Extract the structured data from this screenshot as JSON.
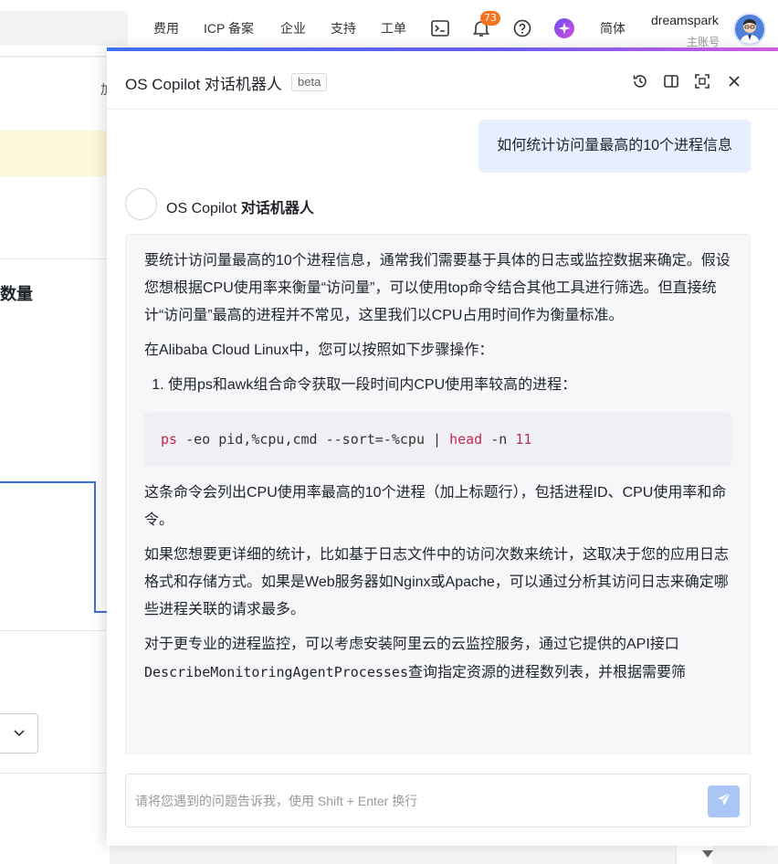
{
  "topnav": {
    "items": [
      "费用",
      "ICP 备案",
      "企业",
      "支持",
      "工单"
    ],
    "notification_count": "73",
    "language": "简体",
    "user": {
      "name": "dreamspark",
      "role": "主账号"
    }
  },
  "background": {
    "section_title": "数量",
    "partial_char": "加"
  },
  "copilot": {
    "title": "OS Copilot 对话机器人",
    "beta": "beta",
    "user_message": "如何统计访问量最高的10个进程信息",
    "bot": {
      "name_prefix": "OS Copilot ",
      "name_bold": "对话机器人"
    },
    "answer": {
      "p1": "要统计访问量最高的10个进程信息，通常我们需要基于具体的日志或监控数据来确定。假设您想根据CPU使用率来衡量“访问量”，可以使用top命令结合其他工具进行筛选。但直接统计“访问量”最高的进程并不常见，这里我们以CPU占用时间作为衡量标准。",
      "p2": "在Alibaba Cloud Linux中，您可以按照如下步骤操作：",
      "step1": "使用ps和awk组合命令获取一段时间内CPU使用率较高的进程：",
      "code": {
        "cmd1": "ps",
        "args1": " -eo pid,%cpu,cmd --sort=-%cpu | ",
        "cmd2": "head",
        "args2": " -n ",
        "num": "11"
      },
      "p3": "这条命令会列出CPU使用率最高的10个进程（加上标题行），包括进程ID、CPU使用率和命令。",
      "p4": "如果您想要更详细的统计，比如基于日志文件中的访问次数来统计，这取决于您的应用日志格式和存储方式。如果是Web服务器如Nginx或Apache，可以通过分析其访问日志来确定哪些进程关联的请求最多。",
      "p5_a": "对于更专业的进程监控，可以考虑安装阿里云的云监控服务，通过它提供的API接口",
      "p5_code": "DescribeMonitoringAgentProcesses",
      "p5_b": "查询指定资源的进程数列表，并根据需要筛"
    },
    "input_placeholder": "请将您遇到的问题告诉我，使用 Shift + Enter 换行"
  },
  "colors": {
    "accent": "#3f6ff5",
    "user_bubble": "#e6efff",
    "badge": "#f5731f"
  }
}
